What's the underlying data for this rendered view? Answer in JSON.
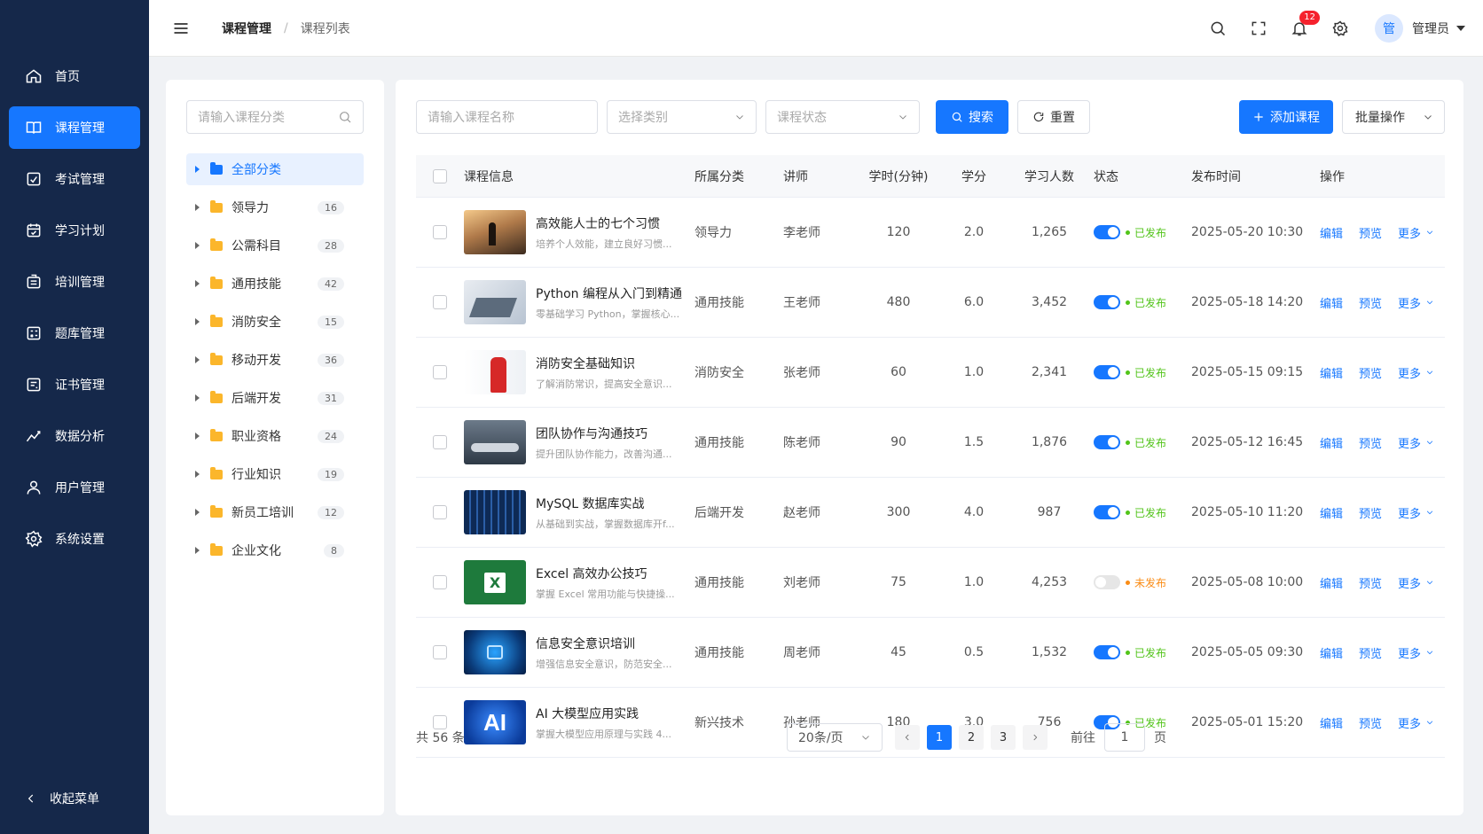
{
  "sidebar": {
    "items": [
      {
        "label": "首页",
        "icon": "home-icon"
      },
      {
        "label": "课程管理",
        "icon": "book-icon"
      },
      {
        "label": "考试管理",
        "icon": "exam-icon"
      },
      {
        "label": "学习计划",
        "icon": "calendar-icon"
      },
      {
        "label": "培训管理",
        "icon": "training-icon"
      },
      {
        "label": "题库管理",
        "icon": "question-bank-icon"
      },
      {
        "label": "证书管理",
        "icon": "certificate-icon"
      },
      {
        "label": "数据分析",
        "icon": "chart-icon"
      },
      {
        "label": "用户管理",
        "icon": "user-icon"
      },
      {
        "label": "系统设置",
        "icon": "gear-icon"
      }
    ],
    "active_index": 1,
    "collapse_label": "收起菜单"
  },
  "header": {
    "breadcrumb": [
      "课程管理",
      "课程列表"
    ],
    "separator": "/",
    "notification_count": "12",
    "avatar_text": "管",
    "user_name": "管理员"
  },
  "categories": {
    "search_placeholder": "请输入课程分类",
    "items": [
      {
        "label": "全部分类",
        "count": ""
      },
      {
        "label": "领导力",
        "count": "16"
      },
      {
        "label": "公需科目",
        "count": "28"
      },
      {
        "label": "通用技能",
        "count": "42"
      },
      {
        "label": "消防安全",
        "count": "15"
      },
      {
        "label": "移动开发",
        "count": "36"
      },
      {
        "label": "后端开发",
        "count": "31"
      },
      {
        "label": "职业资格",
        "count": "24"
      },
      {
        "label": "行业知识",
        "count": "19"
      },
      {
        "label": "新员工培训",
        "count": "12"
      },
      {
        "label": "企业文化",
        "count": "8"
      }
    ]
  },
  "filters": {
    "name_placeholder": "请输入课程名称",
    "category_placeholder": "选择类别",
    "status_placeholder": "课程状态",
    "search_label": "搜索",
    "reset_label": "重置",
    "add_label": "添加课程",
    "batch_label": "批量操作"
  },
  "table": {
    "headers": [
      "课程信息",
      "所属分类",
      "讲师",
      "学时(分钟)",
      "学分",
      "学习人数",
      "状态",
      "发布时间",
      "操作"
    ],
    "actions": {
      "edit": "编辑",
      "preview": "预览",
      "more": "更多"
    },
    "rows": [
      {
        "title": "高效能人士的七个习惯",
        "desc": "培养个人效能，建立良好习惯...",
        "category": "领导力",
        "lecturer": "李老师",
        "hours": "120",
        "credit": "2.0",
        "learners": "1,265",
        "published": true,
        "status": "已发布",
        "time": "2025-05-20 10:30"
      },
      {
        "title": "Python 编程从入门到精通",
        "desc": "零基础学习 Python，掌握核心...",
        "category": "通用技能",
        "lecturer": "王老师",
        "hours": "480",
        "credit": "6.0",
        "learners": "3,452",
        "published": true,
        "status": "已发布",
        "time": "2025-05-18 14:20"
      },
      {
        "title": "消防安全基础知识",
        "desc": "了解消防常识，提高安全意识...",
        "category": "消防安全",
        "lecturer": "张老师",
        "hours": "60",
        "credit": "1.0",
        "learners": "2,341",
        "published": true,
        "status": "已发布",
        "time": "2025-05-15 09:15"
      },
      {
        "title": "团队协作与沟通技巧",
        "desc": "提升团队协作能力，改善沟通...",
        "category": "通用技能",
        "lecturer": "陈老师",
        "hours": "90",
        "credit": "1.5",
        "learners": "1,876",
        "published": true,
        "status": "已发布",
        "time": "2025-05-12 16:45"
      },
      {
        "title": "MySQL 数据库实战",
        "desc": "从基础到实战，掌握数据库开f...",
        "category": "后端开发",
        "lecturer": "赵老师",
        "hours": "300",
        "credit": "4.0",
        "learners": "987",
        "published": true,
        "status": "已发布",
        "time": "2025-05-10 11:20"
      },
      {
        "title": "Excel 高效办公技巧",
        "desc": "掌握 Excel 常用功能与快捷操...",
        "category": "通用技能",
        "lecturer": "刘老师",
        "hours": "75",
        "credit": "1.0",
        "learners": "4,253",
        "published": false,
        "status": "未发布",
        "time": "2025-05-08 10:00"
      },
      {
        "title": "信息安全意识培训",
        "desc": "增强信息安全意识，防范安全...",
        "category": "通用技能",
        "lecturer": "周老师",
        "hours": "45",
        "credit": "0.5",
        "learners": "1,532",
        "published": true,
        "status": "已发布",
        "time": "2025-05-05 09:30"
      },
      {
        "title": "AI 大模型应用实践",
        "desc": "掌握大模型应用原理与实践 4...",
        "category": "新兴技术",
        "lecturer": "孙老师",
        "hours": "180",
        "credit": "3.0",
        "learners": "756",
        "published": true,
        "status": "已发布",
        "time": "2025-05-01 15:20"
      }
    ],
    "thumb_labels": {
      "excel": "X",
      "ai": "AI"
    }
  },
  "colors": {
    "primary": "#1677ff",
    "published": "#52c41a",
    "unpublished": "#fa8c16",
    "sidebar_bg": "#15284a"
  },
  "pagination": {
    "total": "共 56 条",
    "page_size": "20条/页",
    "pages": [
      "1",
      "2",
      "3"
    ],
    "current": "1",
    "goto_label": "前往",
    "goto_value": "1",
    "page_suffix": "页"
  }
}
